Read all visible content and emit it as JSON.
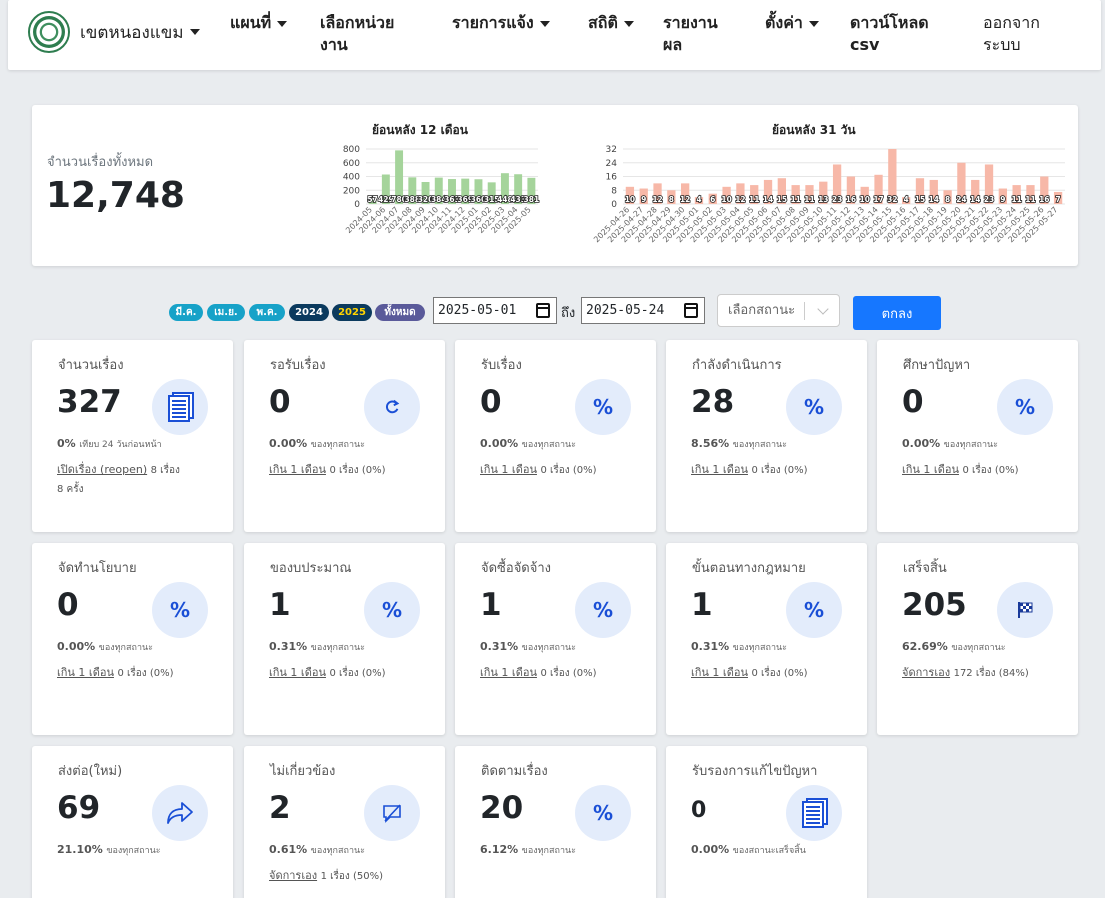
{
  "navbar": {
    "brand": "เขตหนองแขม",
    "items": [
      {
        "label": "แผนที่",
        "dropdown": true
      },
      {
        "label": "เลือกหน่วยงาน",
        "dropdown": false
      },
      {
        "label": "รายการแจ้ง",
        "dropdown": true
      },
      {
        "label": "สถิติ",
        "dropdown": true
      },
      {
        "label": "รายงานผล",
        "dropdown": false
      },
      {
        "label": "ตั้งค่า",
        "dropdown": true
      },
      {
        "label": "ดาวน์โหลด csv",
        "dropdown": false
      },
      {
        "label": "ออกจากระบบ",
        "dropdown": false
      }
    ]
  },
  "summary": {
    "label": "จำนวนเรื่องทั้งหมด",
    "value": "12,748"
  },
  "colors": {
    "bar_month": "#a5d49b",
    "bar_day": "#f7b8a8",
    "accent": "#1677ff"
  },
  "chart_data": [
    {
      "type": "bar",
      "title": "ย้อนหลัง 12 เดือน",
      "categories": [
        "2024-05",
        "2024-06",
        "2024-07",
        "2024-08",
        "2024-09",
        "2024-10",
        "2024-11",
        "2024-12",
        "2025-01",
        "2025-02",
        "2025-03",
        "2025-04",
        "2025-05"
      ],
      "values": [
        57,
        429,
        780,
        388,
        320,
        384,
        363,
        369,
        360,
        315,
        448,
        433,
        381
      ],
      "ylim": [
        0,
        800
      ],
      "yticks": [
        0,
        200,
        400,
        600,
        800
      ],
      "grid": true
    },
    {
      "type": "bar",
      "title": "ย้อนหลัง 31 วัน",
      "categories": [
        "2025-04-26",
        "2025-04-27",
        "2025-04-28",
        "2025-04-29",
        "2025-04-30",
        "2025-05-01",
        "2025-05-02",
        "2025-05-03",
        "2025-05-04",
        "2025-05-05",
        "2025-05-06",
        "2025-05-07",
        "2025-05-08",
        "2025-05-09",
        "2025-05-10",
        "2025-05-11",
        "2025-05-12",
        "2025-05-13",
        "2025-05-14",
        "2025-05-15",
        "2025-05-16",
        "2025-05-17",
        "2025-05-18",
        "2025-05-19",
        "2025-05-20",
        "2025-05-21",
        "2025-05-22",
        "2025-05-23",
        "2025-05-24",
        "2025-05-25",
        "2025-05-26",
        "2025-05-27"
      ],
      "values": [
        10,
        9,
        12,
        8,
        12,
        4,
        6,
        10,
        12,
        11,
        14,
        15,
        11,
        11,
        13,
        23,
        16,
        10,
        17,
        32,
        4,
        15,
        14,
        8,
        24,
        14,
        23,
        9,
        11,
        11,
        16,
        7
      ],
      "ylim": [
        0,
        32
      ],
      "yticks": [
        0,
        8,
        16,
        24,
        32
      ],
      "grid": true
    }
  ],
  "filters": {
    "pills": [
      {
        "label": "มี.ค.",
        "bg": "#17a2c8",
        "fg": "#ffffff"
      },
      {
        "label": "เม.ย.",
        "bg": "#17a2c8",
        "fg": "#ffffff"
      },
      {
        "label": "พ.ค.",
        "bg": "#17a2c8",
        "fg": "#ffffff"
      },
      {
        "label": "2024",
        "bg": "#0b3a5e",
        "fg": "#ffffff"
      },
      {
        "label": "2025",
        "bg": "#0b3a5e",
        "fg": "#ffd400"
      },
      {
        "label": "ทั้งหมด",
        "bg": "#5a5a9a",
        "fg": "#ffffff"
      }
    ],
    "date_from": "2025-05-01",
    "to_label": "ถึง",
    "date_to": "2025-05-24",
    "status_placeholder": "เลือกสถานะ",
    "submit_label": "ตกลง"
  },
  "cards": [
    {
      "title": "จำนวนเรื่อง",
      "value": "327",
      "icon": "documents-icon",
      "sub_pct": "0%",
      "sub_text": "เทียบ 24 วันก่อนหน้า",
      "link": "เปิดเรื่อง (reopen)",
      "link_text": "8 เรื่อง",
      "link_extra": "8 ครั้ง"
    },
    {
      "title": "รอรับเรื่อง",
      "value": "0",
      "icon": "refresh-icon",
      "sub_pct": "0.00%",
      "sub_text": "ของทุกสถานะ",
      "link": "เกิน 1 เดือน",
      "link_text": "0 เรื่อง (0%)",
      "link_extra": ""
    },
    {
      "title": "รับเรื่อง",
      "value": "0",
      "icon": "percent-icon",
      "sub_pct": "0.00%",
      "sub_text": "ของทุกสถานะ",
      "link": "เกิน 1 เดือน",
      "link_text": "0 เรื่อง (0%)",
      "link_extra": ""
    },
    {
      "title": "กำลังดำเนินการ",
      "value": "28",
      "icon": "percent-icon",
      "sub_pct": "8.56%",
      "sub_text": "ของทุกสถานะ",
      "link": "เกิน 1 เดือน",
      "link_text": "0 เรื่อง (0%)",
      "link_extra": ""
    },
    {
      "title": "ศึกษาปัญหา",
      "value": "0",
      "icon": "percent-icon",
      "sub_pct": "0.00%",
      "sub_text": "ของทุกสถานะ",
      "link": "เกิน 1 เดือน",
      "link_text": "0 เรื่อง (0%)",
      "link_extra": ""
    },
    {
      "title": "จัดทำนโยบาย",
      "value": "0",
      "icon": "percent-icon",
      "sub_pct": "0.00%",
      "sub_text": "ของทุกสถานะ",
      "link": "เกิน 1 เดือน",
      "link_text": "0 เรื่อง (0%)",
      "link_extra": ""
    },
    {
      "title": "ของบประมาณ",
      "value": "1",
      "icon": "percent-icon",
      "sub_pct": "0.31%",
      "sub_text": "ของทุกสถานะ",
      "link": "เกิน 1 เดือน",
      "link_text": "0 เรื่อง (0%)",
      "link_extra": ""
    },
    {
      "title": "จัดซื้อจัดจ้าง",
      "value": "1",
      "icon": "percent-icon",
      "sub_pct": "0.31%",
      "sub_text": "ของทุกสถานะ",
      "link": "เกิน 1 เดือน",
      "link_text": "0 เรื่อง (0%)",
      "link_extra": ""
    },
    {
      "title": "ขั้นตอนทางกฎหมาย",
      "value": "1",
      "icon": "percent-icon",
      "sub_pct": "0.31%",
      "sub_text": "ของทุกสถานะ",
      "link": "เกิน 1 เดือน",
      "link_text": "0 เรื่อง (0%)",
      "link_extra": ""
    },
    {
      "title": "เสร็จสิ้น",
      "value": "205",
      "icon": "checkered-flag-icon",
      "sub_pct": "62.69%",
      "sub_text": "ของทุกสถานะ",
      "link": "จัดการเอง",
      "link_text": "172 เรื่อง (84%)",
      "link_extra": ""
    },
    {
      "title": "ส่งต่อ(ใหม่)",
      "value": "69",
      "icon": "forward-arrow-icon",
      "sub_pct": "21.10%",
      "sub_text": "ของทุกสถานะ",
      "link": "",
      "link_text": "",
      "link_extra": ""
    },
    {
      "title": "ไม่เกี่ยวข้อง",
      "value": "2",
      "icon": "comment-slash-icon",
      "sub_pct": "0.61%",
      "sub_text": "ของทุกสถานะ",
      "link": "จัดการเอง",
      "link_text": "1 เรื่อง (50%)",
      "link_extra": ""
    },
    {
      "title": "ติดตามเรื่อง",
      "value": "20",
      "icon": "percent-icon",
      "sub_pct": "6.12%",
      "sub_text": "ของทุกสถานะ",
      "link": "",
      "link_text": "",
      "link_extra": ""
    },
    {
      "title": "รับรองการแก้ไขปัญหา",
      "value": "0",
      "icon": "documents-icon",
      "sub_pct": "0.00%",
      "sub_text": "ของสถานะเสร็จสิ้น",
      "link": "",
      "link_text": "",
      "link_extra": ""
    }
  ]
}
